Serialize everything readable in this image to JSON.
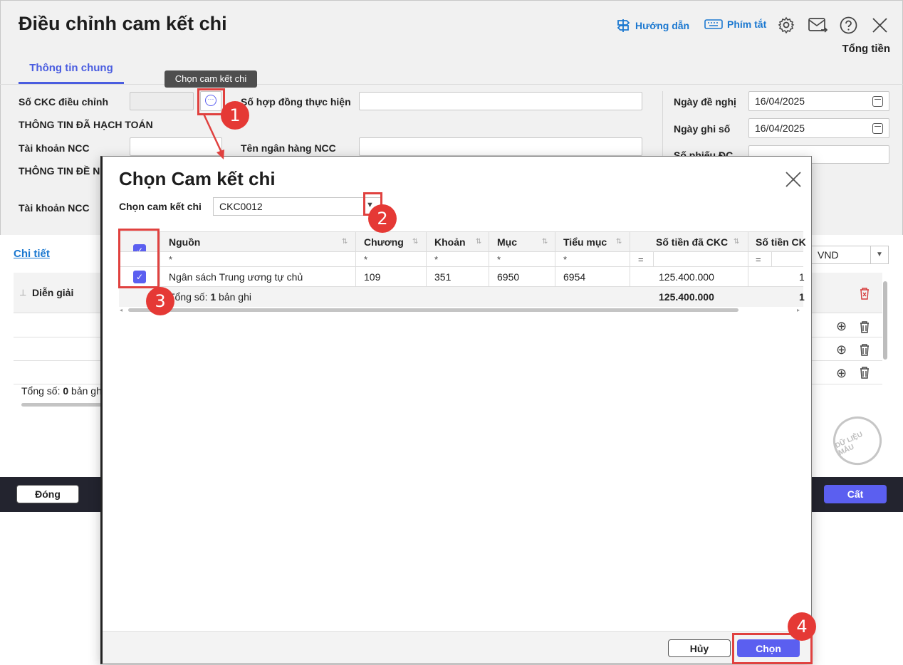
{
  "window": {
    "title": "Điều chỉnh cam kết chi",
    "toolbar": {
      "guide": "Hướng dẫn",
      "shortcuts": "Phím tắt"
    },
    "total_label": "Tổng tiền",
    "tab": "Thông tin chung",
    "tooltip": "Chọn cam kết chi",
    "form": {
      "so_ckc": "Số CKC điều chỉnh",
      "so_hop_dong": "Số hợp đồng thực hiện",
      "thong_tin_hach_toan": "THÔNG TIN ĐÃ HẠCH TOÁN",
      "tai_khoan_ncc_1": "Tài khoản NCC",
      "ten_ngan_hang": "Tên ngân hàng NCC",
      "thong_tin_de_nghi": "THÔNG TIN ĐỀ NG",
      "tai_khoan_ncc_2": "Tài khoản NCC",
      "ngay_de_nghi": "Ngày đề nghị",
      "ngay_de_nghi_value": "16/04/2025",
      "ngay_ghi_so": "Ngày ghi số",
      "ngay_ghi_so_value": "16/04/2025",
      "so_phieu": "Số phiếu ĐC"
    },
    "detail": {
      "link": "Chi tiết",
      "column": "Diễn giải",
      "total_prefix": "Tổng số: ",
      "total_count": "0",
      "total_suffix": " bản gh",
      "currency": "VND"
    },
    "stamp": "DỮ LIỆU MẪU",
    "footer": {
      "close": "Đóng",
      "save": "Cất"
    }
  },
  "modal": {
    "title": "Chọn Cam kết chi",
    "field_label": "Chọn cam kết chi",
    "field_value": "CKC0012",
    "columns": [
      "Nguồn",
      "Chương",
      "Khoản",
      "Mục",
      "Tiểu mục",
      "Số tiền đã CKC",
      "Số tiền CK"
    ],
    "filters": [
      "*",
      "*",
      "*",
      "*",
      "*",
      "=",
      "="
    ],
    "row": {
      "nguon": "Ngân sách Trung ương tự chủ",
      "chuong": "109",
      "khoan": "351",
      "muc": "6950",
      "tieu_muc": "6954",
      "so_tien_ckc": "125.400.000",
      "so_tien_ck": "1"
    },
    "footer_row": {
      "prefix": "Tổng số: ",
      "count": "1",
      "suffix": " bản ghi",
      "total": "125.400.000",
      "total2": "1"
    },
    "buttons": {
      "cancel": "Hủy",
      "choose": "Chọn"
    }
  },
  "annotations": [
    "1",
    "2",
    "3",
    "4"
  ],
  "colors": {
    "accent": "#5b5ff0",
    "annotation_red": "#e53935",
    "link_blue": "#1b78d0"
  }
}
